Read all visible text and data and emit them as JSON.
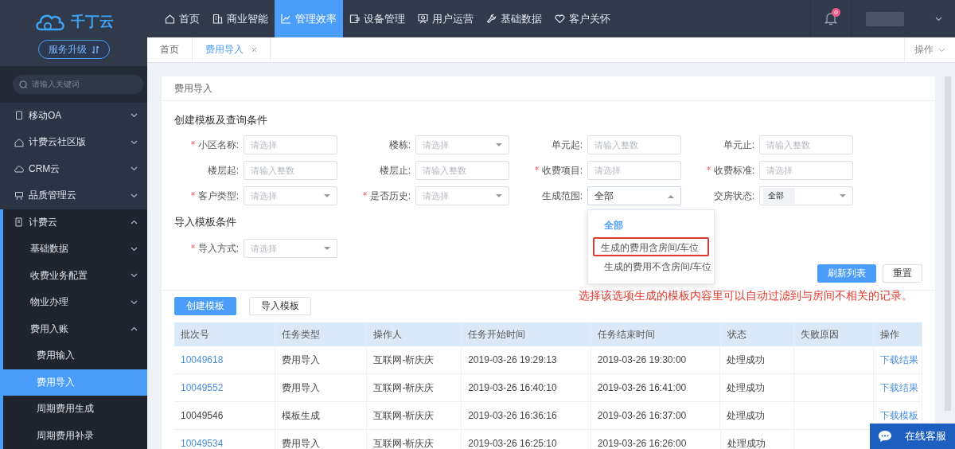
{
  "brand": {
    "name": "千丁云",
    "upgrade_button": "服务升级"
  },
  "search": {
    "placeholder": "请输入关键词"
  },
  "top_nav": [
    {
      "label": "首页",
      "selected": false
    },
    {
      "label": "商业智能",
      "selected": false
    },
    {
      "label": "管理效率",
      "selected": true
    },
    {
      "label": "设备管理",
      "selected": false
    },
    {
      "label": "用户运营",
      "selected": false
    },
    {
      "label": "基础数据",
      "selected": false
    },
    {
      "label": "客户关怀",
      "selected": false
    }
  ],
  "notifications": {
    "count": "0"
  },
  "sidebar": [
    {
      "label": "移动OA",
      "expanded": false
    },
    {
      "label": "计费云社区版",
      "expanded": false
    },
    {
      "label": "CRM云",
      "expanded": false
    },
    {
      "label": "品质管理云",
      "expanded": false
    },
    {
      "label": "计费云",
      "expanded": true,
      "children": [
        {
          "label": "基础数据",
          "expanded": false
        },
        {
          "label": "收费业务配置",
          "expanded": false
        },
        {
          "label": "物业办理",
          "expanded": false
        },
        {
          "label": "费用入账",
          "expanded": true,
          "children": [
            {
              "label": "费用输入",
              "selected": false
            },
            {
              "label": "费用导入",
              "selected": true
            },
            {
              "label": "周期费用生成",
              "selected": false
            },
            {
              "label": "周期费用补录",
              "selected": false
            }
          ]
        }
      ]
    }
  ],
  "tabs": [
    {
      "label": "首页",
      "selected": false,
      "closable": false
    },
    {
      "label": "费用导入",
      "selected": true,
      "closable": true
    }
  ],
  "tabs_menu": "操作",
  "page": {
    "title": "费用导入",
    "section_create": "创建模板及查询条件",
    "fields": [
      {
        "label": "小区名称:",
        "required": true,
        "kind": "input",
        "placeholder": "请选择"
      },
      {
        "label": "楼栋:",
        "required": false,
        "kind": "select",
        "placeholder": "请选择",
        "open": false
      },
      {
        "label": "单元起:",
        "required": false,
        "kind": "input",
        "placeholder": "请输入整数"
      },
      {
        "label": "单元止:",
        "required": false,
        "kind": "input",
        "placeholder": "请输入整数"
      },
      {
        "label": "楼层起:",
        "required": false,
        "kind": "input",
        "placeholder": "请输入整数"
      },
      {
        "label": "楼层止:",
        "required": false,
        "kind": "input",
        "placeholder": "请输入整数"
      },
      {
        "label": "收费项目:",
        "required": true,
        "kind": "input",
        "placeholder": "请选择"
      },
      {
        "label": "收费标准:",
        "required": true,
        "kind": "input",
        "placeholder": "请选择"
      },
      {
        "label": "客户类型:",
        "required": true,
        "kind": "select",
        "placeholder": "请选择",
        "open": false
      },
      {
        "label": "是否历史:",
        "required": true,
        "kind": "select",
        "placeholder": "请选择",
        "open": false
      },
      {
        "label": "生成范围:",
        "required": false,
        "kind": "select",
        "value": "全部",
        "open": true,
        "options": [
          {
            "label": "全部",
            "selected": true,
            "highlighted": false
          },
          {
            "label": "生成的费用含房间/车位",
            "selected": false,
            "highlighted": true
          },
          {
            "label": "生成的费用不含房间/车位",
            "selected": false,
            "highlighted": false
          }
        ]
      },
      {
        "label": "交房状态:",
        "required": false,
        "kind": "tags",
        "tags": [
          "全部"
        ],
        "open": false
      }
    ],
    "section_import": "导入模板条件",
    "import_fields": [
      {
        "label": "导入方式:",
        "required": true,
        "kind": "select",
        "placeholder": "请选择",
        "open": false
      }
    ],
    "buttons": {
      "refresh": "刷新列表",
      "reset": "重置",
      "create": "创建模板",
      "import": "导入模板"
    },
    "annotation": "选择该选项生成的模板内容里可以自动过滤到与房间不相关的记录。",
    "table": {
      "columns": [
        "批次号",
        "任务类型",
        "操作人",
        "任务开始时间",
        "任务结束时间",
        "状态",
        "失败原因",
        "操作"
      ],
      "rows": [
        {
          "batch": "10049618",
          "linked": true,
          "type": "费用导入",
          "operator": "互联网-靳庆庆",
          "start": "2019-03-26 19:29:13",
          "end": "2019-03-26 19:30:00",
          "status": "处理成功",
          "action": "下载结果"
        },
        {
          "batch": "10049552",
          "linked": true,
          "type": "费用导入",
          "operator": "互联网-靳庆庆",
          "start": "2019-03-26 16:40:10",
          "end": "2019-03-26 16:41:00",
          "status": "处理成功",
          "action": "下载结果"
        },
        {
          "batch": "10049546",
          "linked": false,
          "type": "模板生成",
          "operator": "互联网-靳庆庆",
          "start": "2019-03-26 16:36:16",
          "end": "2019-03-26 16:37:00",
          "status": "处理成功",
          "action": "下载模板"
        },
        {
          "batch": "10049534",
          "linked": true,
          "type": "费用导入",
          "operator": "互联网-靳庆庆",
          "start": "2019-03-26 16:25:10",
          "end": "2019-03-26 16:26:00",
          "status": "处理成功"
        }
      ]
    }
  },
  "chat_button": "在线客服"
}
